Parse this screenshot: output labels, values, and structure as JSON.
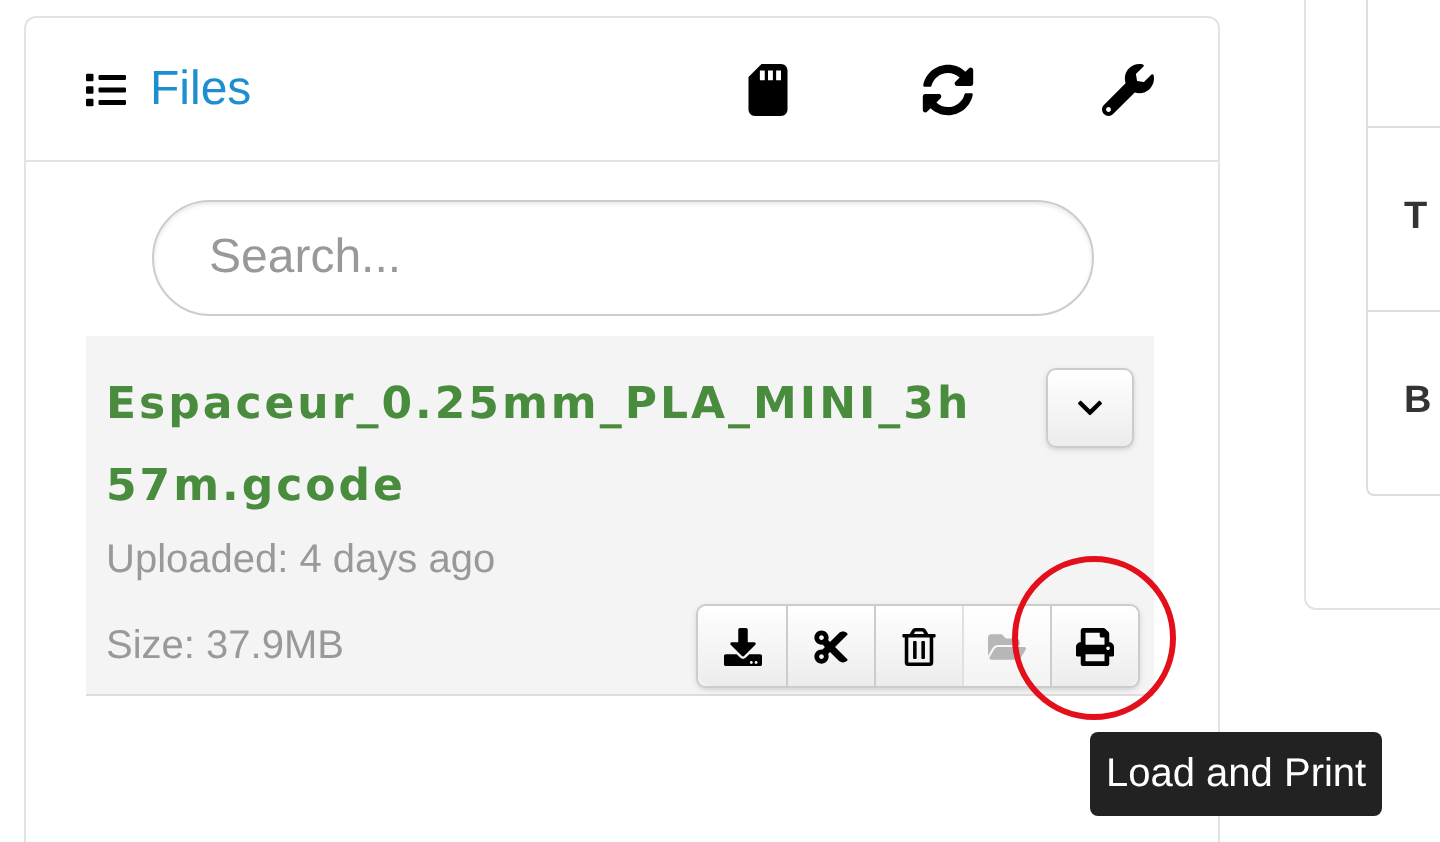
{
  "panel": {
    "title": "Files",
    "tools": [
      {
        "kind": "sd-card"
      },
      {
        "kind": "refresh"
      },
      {
        "kind": "wrench"
      }
    ]
  },
  "search": {
    "placeholder": "Search..."
  },
  "file": {
    "name": "Espaceur_0.25mm_PLA_MINI_3h57m.gcode",
    "uploaded": "Uploaded: 4 days ago",
    "size": "Size: 37.9MB",
    "actions": [
      {
        "kind": "download",
        "disabled": false,
        "circled": false
      },
      {
        "kind": "cut",
        "disabled": false,
        "circled": false
      },
      {
        "kind": "delete",
        "disabled": false,
        "circled": false
      },
      {
        "kind": "folder",
        "disabled": true,
        "circled": false
      },
      {
        "kind": "print",
        "disabled": false,
        "circled": true
      }
    ]
  },
  "tooltip": {
    "text": "Load and Print"
  },
  "side_table": {
    "rows": [
      {
        "label": ""
      },
      {
        "label": "T"
      },
      {
        "label": "B"
      }
    ]
  }
}
